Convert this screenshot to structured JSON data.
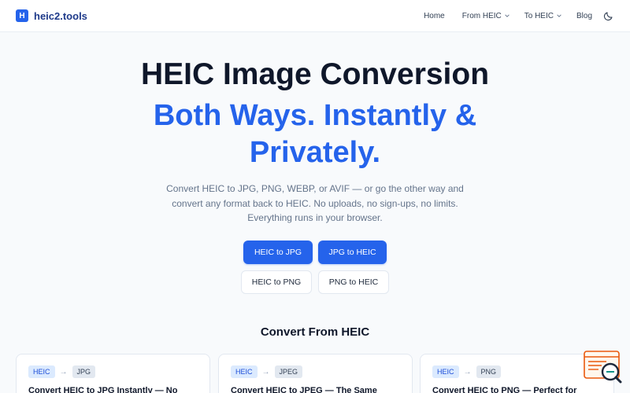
{
  "header": {
    "logo_letter": "H",
    "logo_text": "heic2.tools",
    "nav": [
      {
        "label": "Home"
      },
      {
        "label": "From HEIC"
      },
      {
        "label": "To HEIC"
      },
      {
        "label": "Blog"
      }
    ],
    "theme_icon": "moon-icon"
  },
  "hero": {
    "title": "HEIC Image Conversion",
    "subtitle_line1": "Both Ways. Instantly &",
    "subtitle_line2": "Privately.",
    "description": "Convert HEIC to JPG, PNG, WEBP, or AVIF — or go the other way and convert any format back to HEIC. No uploads, no sign-ups, no limits. Everything runs in your browser.",
    "buttons": {
      "heic_to_jpg": "HEIC to JPG",
      "jpg_to_heic": "JPG to HEIC",
      "heic_to_png": "HEIC to PNG",
      "png_to_heic": "PNG to HEIC"
    }
  },
  "section": {
    "title": "Convert From HEIC",
    "cards": [
      {
        "from": "HEIC",
        "to": "JPG",
        "title": "Convert HEIC to JPG Instantly — No"
      },
      {
        "from": "HEIC",
        "to": "JPEG",
        "title": "Convert HEIC to JPEG — The Same"
      },
      {
        "from": "HEIC",
        "to": "PNG",
        "title": "Convert HEIC to PNG — Perfect for"
      }
    ]
  },
  "colors": {
    "accent": "#2563eb",
    "title": "#0f172a",
    "muted": "#64748b"
  }
}
